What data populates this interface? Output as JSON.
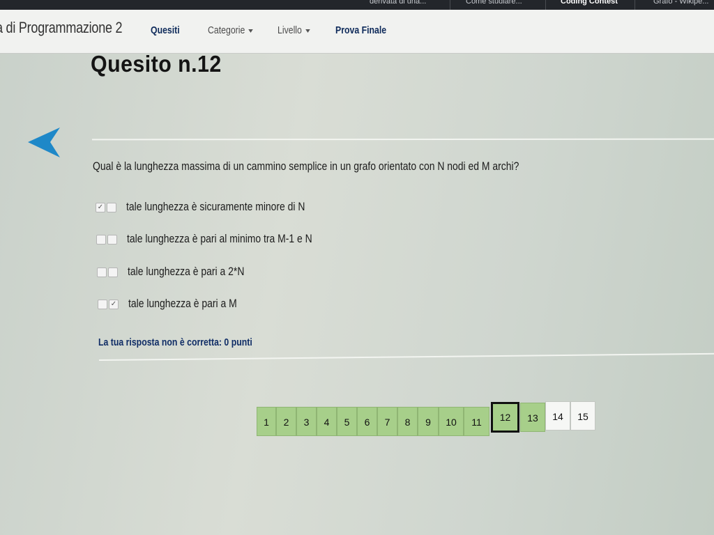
{
  "browser_tabs": [
    "derivata di una...",
    "Come studiare...",
    "Coding Contest",
    "Grafo - Wikipe..."
  ],
  "navbar": {
    "brand": "a di Programmazione 2",
    "items": [
      {
        "label": "Quesiti",
        "style": "bold"
      },
      {
        "label": "Categorie",
        "dropdown": true
      },
      {
        "label": "Livello",
        "dropdown": true
      },
      {
        "label": "Prova Finale",
        "style": "bold"
      }
    ]
  },
  "quiz": {
    "title": "Quesito n.12",
    "question": "Qual è la lunghezza massima di un cammino semplice in un grafo orientato con N nodi ed M archi?",
    "options": [
      {
        "label": "tale lunghezza è sicuramente minore di N",
        "checks": [
          "✓",
          ""
        ]
      },
      {
        "label": "tale lunghezza è pari al minimo tra M-1 e N",
        "checks": [
          "",
          ""
        ]
      },
      {
        "label": "tale lunghezza è pari a 2*N",
        "checks": [
          "",
          ""
        ]
      },
      {
        "label": "tale lunghezza è pari a M",
        "checks": [
          "",
          "✓"
        ]
      }
    ],
    "feedback": "La tua risposta non è corretta: 0 punti"
  },
  "pagination": {
    "pages": [
      "1",
      "2",
      "3",
      "4",
      "5",
      "6",
      "7",
      "8",
      "9",
      "10",
      "11",
      "12",
      "13",
      "14",
      "15"
    ],
    "current": "12",
    "answered_color": "#a7cf8a",
    "unanswered_color": "#f6f7f5"
  },
  "colors": {
    "accent_blue": "#1e88c8",
    "feedback_navy": "#102d66"
  }
}
